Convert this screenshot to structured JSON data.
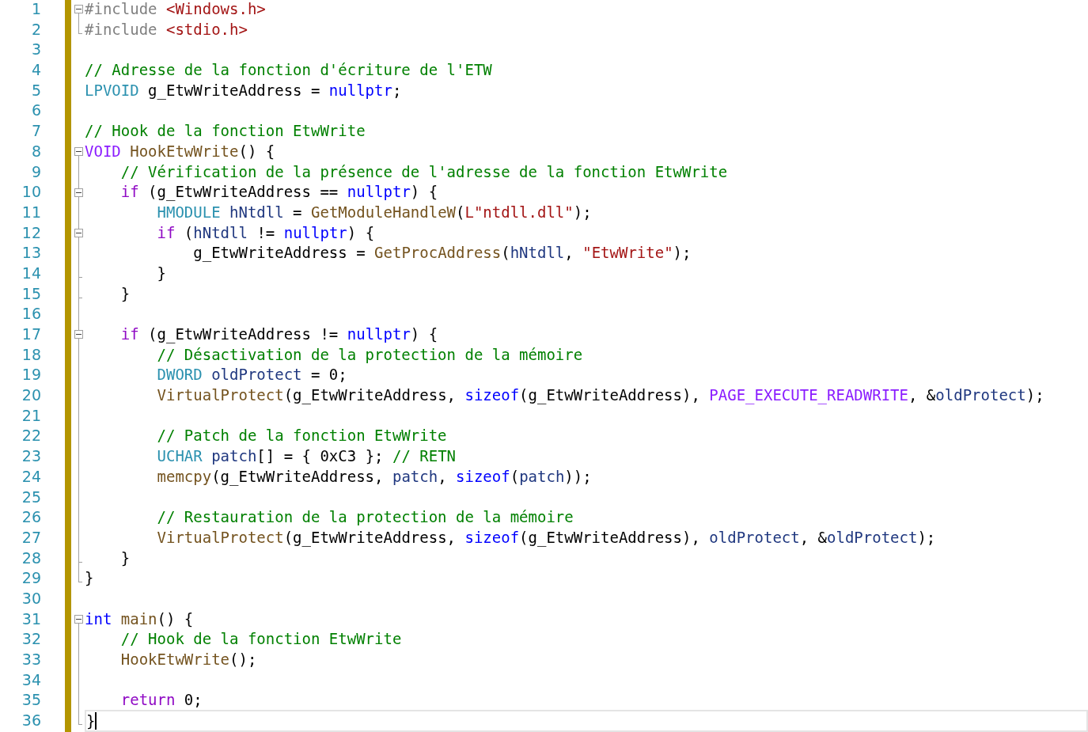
{
  "editor": {
    "lines": [
      {
        "number": "1",
        "collapsible": true,
        "region_end": false,
        "current": false,
        "tokens": [
          {
            "kind": "preproc",
            "text": "#include "
          },
          {
            "kind": "include",
            "text": "<Windows.h>"
          }
        ]
      },
      {
        "number": "2",
        "collapsible": false,
        "region_end": true,
        "current": false,
        "tokens": [
          {
            "kind": "preproc",
            "text": "#include "
          },
          {
            "kind": "include",
            "text": "<stdio.h>"
          }
        ]
      },
      {
        "number": "3",
        "collapsible": false,
        "region_end": false,
        "current": false
      },
      {
        "number": "4",
        "collapsible": false,
        "region_end": false,
        "current": false,
        "tokens": [
          {
            "kind": "comment",
            "text": "// Adresse de la fonction d'écriture de l'ETW"
          }
        ]
      },
      {
        "number": "5",
        "collapsible": false,
        "region_end": false,
        "current": false,
        "tokens": [
          {
            "kind": "type",
            "text": "LPVOID"
          },
          {
            "kind": "plain",
            "text": " g_EtwWriteAddress = "
          },
          {
            "kind": "keyword",
            "text": "nullptr"
          },
          {
            "kind": "plain",
            "text": ";"
          }
        ]
      },
      {
        "number": "6",
        "collapsible": false,
        "region_end": false,
        "current": false
      },
      {
        "number": "7",
        "collapsible": false,
        "region_end": false,
        "current": false,
        "tokens": [
          {
            "kind": "comment",
            "text": "// Hook de la fonction EtwWrite"
          }
        ]
      },
      {
        "number": "8",
        "collapsible": true,
        "region_end": false,
        "current": false,
        "tokens": [
          {
            "kind": "macro",
            "text": "VOID "
          },
          {
            "kind": "function",
            "text": "HookEtwWrite"
          },
          {
            "kind": "plain",
            "text": "() {"
          }
        ]
      },
      {
        "number": "9",
        "collapsible": false,
        "region_end": false,
        "current": false,
        "tokens": [
          {
            "kind": "comment",
            "text": "    // Vérification de la présence de l'adresse de la fonction EtwWrite"
          }
        ]
      },
      {
        "number": "10",
        "collapsible": true,
        "region_end": false,
        "current": false,
        "tokens": [
          {
            "kind": "control",
            "text": "    if"
          },
          {
            "kind": "plain",
            "text": " (g_EtwWriteAddress == "
          },
          {
            "kind": "keyword",
            "text": "nullptr"
          },
          {
            "kind": "plain",
            "text": ") {"
          }
        ]
      },
      {
        "number": "11",
        "collapsible": false,
        "region_end": false,
        "current": false,
        "tokens": [
          {
            "kind": "type",
            "text": "        HMODULE "
          },
          {
            "kind": "local",
            "text": "hNtdll"
          },
          {
            "kind": "plain",
            "text": " = "
          },
          {
            "kind": "function",
            "text": "GetModuleHandleW"
          },
          {
            "kind": "plain",
            "text": "("
          },
          {
            "kind": "string",
            "text": "L\"ntdll.dll\""
          },
          {
            "kind": "plain",
            "text": ");"
          }
        ]
      },
      {
        "number": "12",
        "collapsible": true,
        "region_end": false,
        "current": false,
        "tokens": [
          {
            "kind": "control",
            "text": "        if"
          },
          {
            "kind": "plain",
            "text": " ("
          },
          {
            "kind": "local",
            "text": "hNtdll"
          },
          {
            "kind": "plain",
            "text": " != "
          },
          {
            "kind": "keyword",
            "text": "nullptr"
          },
          {
            "kind": "plain",
            "text": ") {"
          }
        ]
      },
      {
        "number": "13",
        "collapsible": false,
        "region_end": false,
        "current": false,
        "tokens": [
          {
            "kind": "plain",
            "text": "            g_EtwWriteAddress = "
          },
          {
            "kind": "function",
            "text": "GetProcAddress"
          },
          {
            "kind": "plain",
            "text": "("
          },
          {
            "kind": "local",
            "text": "hNtdll"
          },
          {
            "kind": "plain",
            "text": ", "
          },
          {
            "kind": "string",
            "text": "\"EtwWrite\""
          },
          {
            "kind": "plain",
            "text": ");"
          }
        ]
      },
      {
        "number": "14",
        "collapsible": false,
        "region_end": true,
        "current": false,
        "tokens": [
          {
            "kind": "plain",
            "text": "        }"
          }
        ]
      },
      {
        "number": "15",
        "collapsible": false,
        "region_end": true,
        "current": false,
        "tokens": [
          {
            "kind": "plain",
            "text": "    }"
          }
        ]
      },
      {
        "number": "16",
        "collapsible": false,
        "region_end": false,
        "current": false
      },
      {
        "number": "17",
        "collapsible": true,
        "region_end": false,
        "current": false,
        "tokens": [
          {
            "kind": "control",
            "text": "    if"
          },
          {
            "kind": "plain",
            "text": " (g_EtwWriteAddress != "
          },
          {
            "kind": "keyword",
            "text": "nullptr"
          },
          {
            "kind": "plain",
            "text": ") {"
          }
        ]
      },
      {
        "number": "18",
        "collapsible": false,
        "region_end": false,
        "current": false,
        "tokens": [
          {
            "kind": "comment",
            "text": "        // Désactivation de la protection de la mémoire"
          }
        ]
      },
      {
        "number": "19",
        "collapsible": false,
        "region_end": false,
        "current": false,
        "tokens": [
          {
            "kind": "type",
            "text": "        DWORD "
          },
          {
            "kind": "local",
            "text": "oldProtect"
          },
          {
            "kind": "plain",
            "text": " = 0;"
          }
        ]
      },
      {
        "number": "20",
        "collapsible": false,
        "region_end": false,
        "current": false,
        "tokens": [
          {
            "kind": "function",
            "text": "        VirtualProtect"
          },
          {
            "kind": "plain",
            "text": "(g_EtwWriteAddress, "
          },
          {
            "kind": "keyword",
            "text": "sizeof"
          },
          {
            "kind": "plain",
            "text": "(g_EtwWriteAddress), "
          },
          {
            "kind": "macro",
            "text": "PAGE_EXECUTE_READWRITE"
          },
          {
            "kind": "plain",
            "text": ", &"
          },
          {
            "kind": "local",
            "text": "oldProtect"
          },
          {
            "kind": "plain",
            "text": ");"
          }
        ]
      },
      {
        "number": "21",
        "collapsible": false,
        "region_end": false,
        "current": false
      },
      {
        "number": "22",
        "collapsible": false,
        "region_end": false,
        "current": false,
        "tokens": [
          {
            "kind": "comment",
            "text": "        // Patch de la fonction EtwWrite"
          }
        ]
      },
      {
        "number": "23",
        "collapsible": false,
        "region_end": false,
        "current": false,
        "tokens": [
          {
            "kind": "type",
            "text": "        UCHAR "
          },
          {
            "kind": "local",
            "text": "patch"
          },
          {
            "kind": "plain",
            "text": "[] = { 0xC3 }; "
          },
          {
            "kind": "comment",
            "text": "// RETN"
          }
        ]
      },
      {
        "number": "24",
        "collapsible": false,
        "region_end": false,
        "current": false,
        "tokens": [
          {
            "kind": "function",
            "text": "        memcpy"
          },
          {
            "kind": "plain",
            "text": "(g_EtwWriteAddress, "
          },
          {
            "kind": "local",
            "text": "patch"
          },
          {
            "kind": "plain",
            "text": ", "
          },
          {
            "kind": "keyword",
            "text": "sizeof"
          },
          {
            "kind": "plain",
            "text": "("
          },
          {
            "kind": "local",
            "text": "patch"
          },
          {
            "kind": "plain",
            "text": "));"
          }
        ]
      },
      {
        "number": "25",
        "collapsible": false,
        "region_end": false,
        "current": false
      },
      {
        "number": "26",
        "collapsible": false,
        "region_end": false,
        "current": false,
        "tokens": [
          {
            "kind": "comment",
            "text": "        // Restauration de la protection de la mémoire"
          }
        ]
      },
      {
        "number": "27",
        "collapsible": false,
        "region_end": false,
        "current": false,
        "tokens": [
          {
            "kind": "function",
            "text": "        VirtualProtect"
          },
          {
            "kind": "plain",
            "text": "(g_EtwWriteAddress, "
          },
          {
            "kind": "keyword",
            "text": "sizeof"
          },
          {
            "kind": "plain",
            "text": "(g_EtwWriteAddress), "
          },
          {
            "kind": "local",
            "text": "oldProtect"
          },
          {
            "kind": "plain",
            "text": ", &"
          },
          {
            "kind": "local",
            "text": "oldProtect"
          },
          {
            "kind": "plain",
            "text": ");"
          }
        ]
      },
      {
        "number": "28",
        "collapsible": false,
        "region_end": true,
        "current": false,
        "tokens": [
          {
            "kind": "plain",
            "text": "    }"
          }
        ]
      },
      {
        "number": "29",
        "collapsible": false,
        "region_end": true,
        "current": false,
        "tokens": [
          {
            "kind": "plain",
            "text": "}"
          }
        ]
      },
      {
        "number": "30",
        "collapsible": false,
        "region_end": false,
        "current": false
      },
      {
        "number": "31",
        "collapsible": true,
        "region_end": false,
        "current": false,
        "tokens": [
          {
            "kind": "keyword",
            "text": "int "
          },
          {
            "kind": "function",
            "text": "main"
          },
          {
            "kind": "plain",
            "text": "() {"
          }
        ]
      },
      {
        "number": "32",
        "collapsible": false,
        "region_end": false,
        "current": false,
        "tokens": [
          {
            "kind": "comment",
            "text": "    // Hook de la fonction EtwWrite"
          }
        ]
      },
      {
        "number": "33",
        "collapsible": false,
        "region_end": false,
        "current": false,
        "tokens": [
          {
            "kind": "function",
            "text": "    HookEtwWrite"
          },
          {
            "kind": "plain",
            "text": "();"
          }
        ]
      },
      {
        "number": "34",
        "collapsible": false,
        "region_end": false,
        "current": false
      },
      {
        "number": "35",
        "collapsible": false,
        "region_end": false,
        "current": false,
        "tokens": [
          {
            "kind": "control",
            "text": "    return"
          },
          {
            "kind": "plain",
            "text": " 0;"
          }
        ]
      },
      {
        "number": "36",
        "collapsible": false,
        "region_end": true,
        "current": true,
        "tokens": [
          {
            "kind": "plain",
            "text": "}"
          }
        ]
      }
    ]
  }
}
